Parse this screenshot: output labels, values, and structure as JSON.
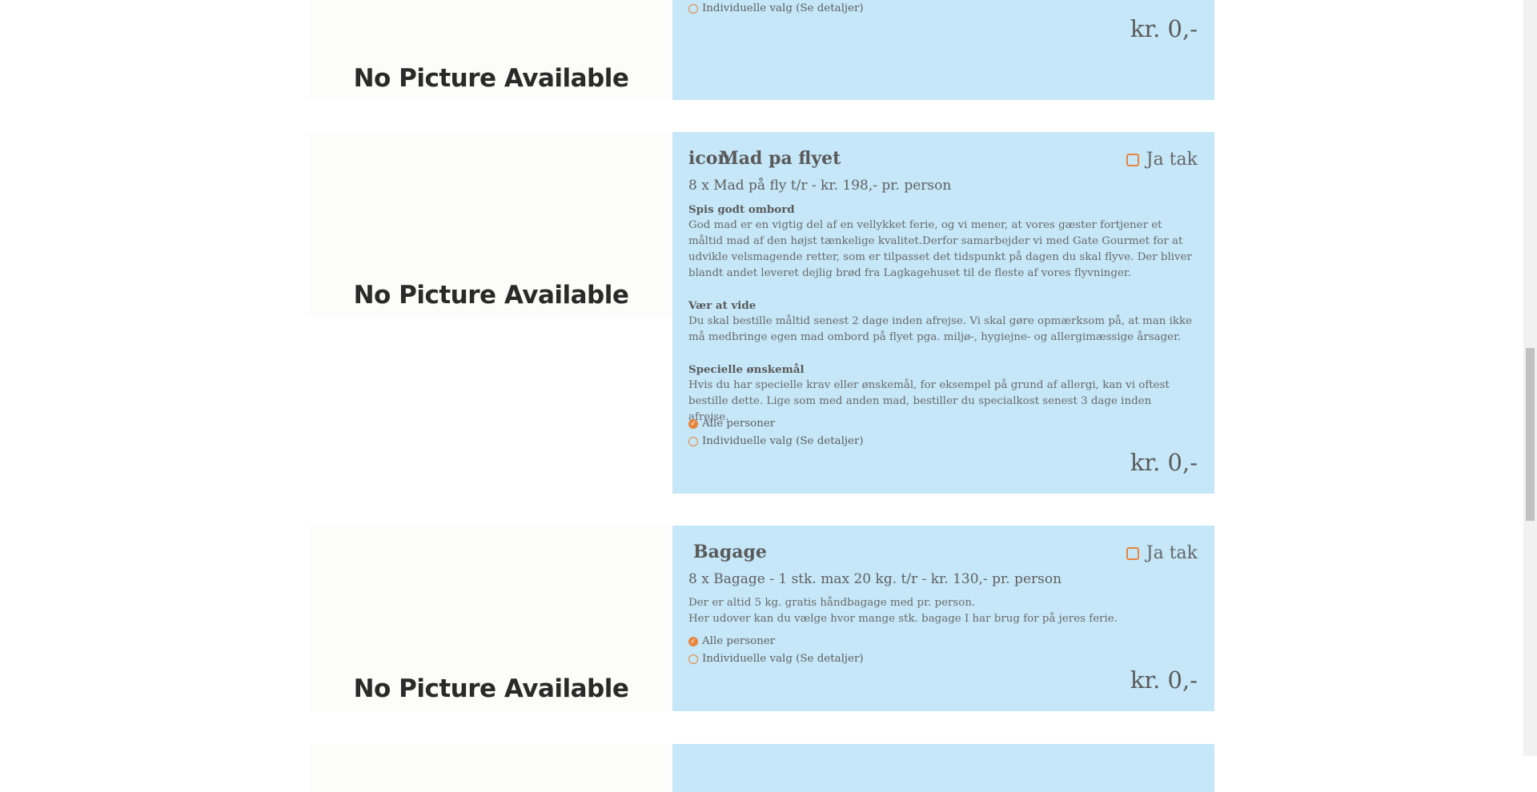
{
  "currency_price": "kr. 0,-",
  "placeholder_image_text": "No Picture Available",
  "accent_color": "#e8843f",
  "card_bg": "#c5e7f8",
  "card0": {
    "option_individual": "Individuelle valg (Se detaljer)",
    "price": "kr. 0,-"
  },
  "card1": {
    "title_prefix": "icon",
    "title": "Mad pa flyet",
    "accept_label": "Ja tak",
    "subtitle": "8 x Mad på fly t/r - kr. 198,- pr. person",
    "heading1": "Spis godt ombord",
    "text1": "God mad er en vigtig del af en vellykket ferie, og vi mener, at vores gæster fortjener et måltid mad af den højst tænkelige kvalitet.Derfor samarbejder vi med Gate Gourmet for at udvikle velsmagende retter, som er tilpasset det tidspunkt på dagen du skal flyve. Der bliver blandt andet leveret dejlig brød fra Lagkagehuset til de fleste af vores flyvninger.",
    "heading2": "Vær at vide",
    "text2": "Du skal bestille måltid senest 2 dage inden afrejse. Vi skal gøre opmærksom på, at man ikke må medbringe egen mad ombord på flyet pga. miljø-, hygiejne- og allergimæssige årsager.",
    "heading3": "Specielle ønskemål",
    "text3": "Hvis du har specielle krav eller ønskemål, for eksempel på grund af allergi, kan vi oftest bestille dette. Lige som med anden mad, bestiller du specialkost senest 3 dage inden afrejse.",
    "option_all": "Alle personer",
    "option_individual": "Individuelle valg (Se detaljer)",
    "price": "kr. 0,-"
  },
  "card2": {
    "title": "Bagage",
    "accept_label": "Ja tak",
    "subtitle": "8 x Bagage - 1 stk. max 20 kg. t/r - kr. 130,- pr. person",
    "line1": "Der er altid 5 kg. gratis håndbagage med pr. person.",
    "line2": "Her udover kan du vælge hvor mange stk. bagage I har brug for på jeres ferie.",
    "option_all": "Alle personer",
    "option_individual": "Individuelle valg (Se detaljer)",
    "price": "kr. 0,-"
  }
}
